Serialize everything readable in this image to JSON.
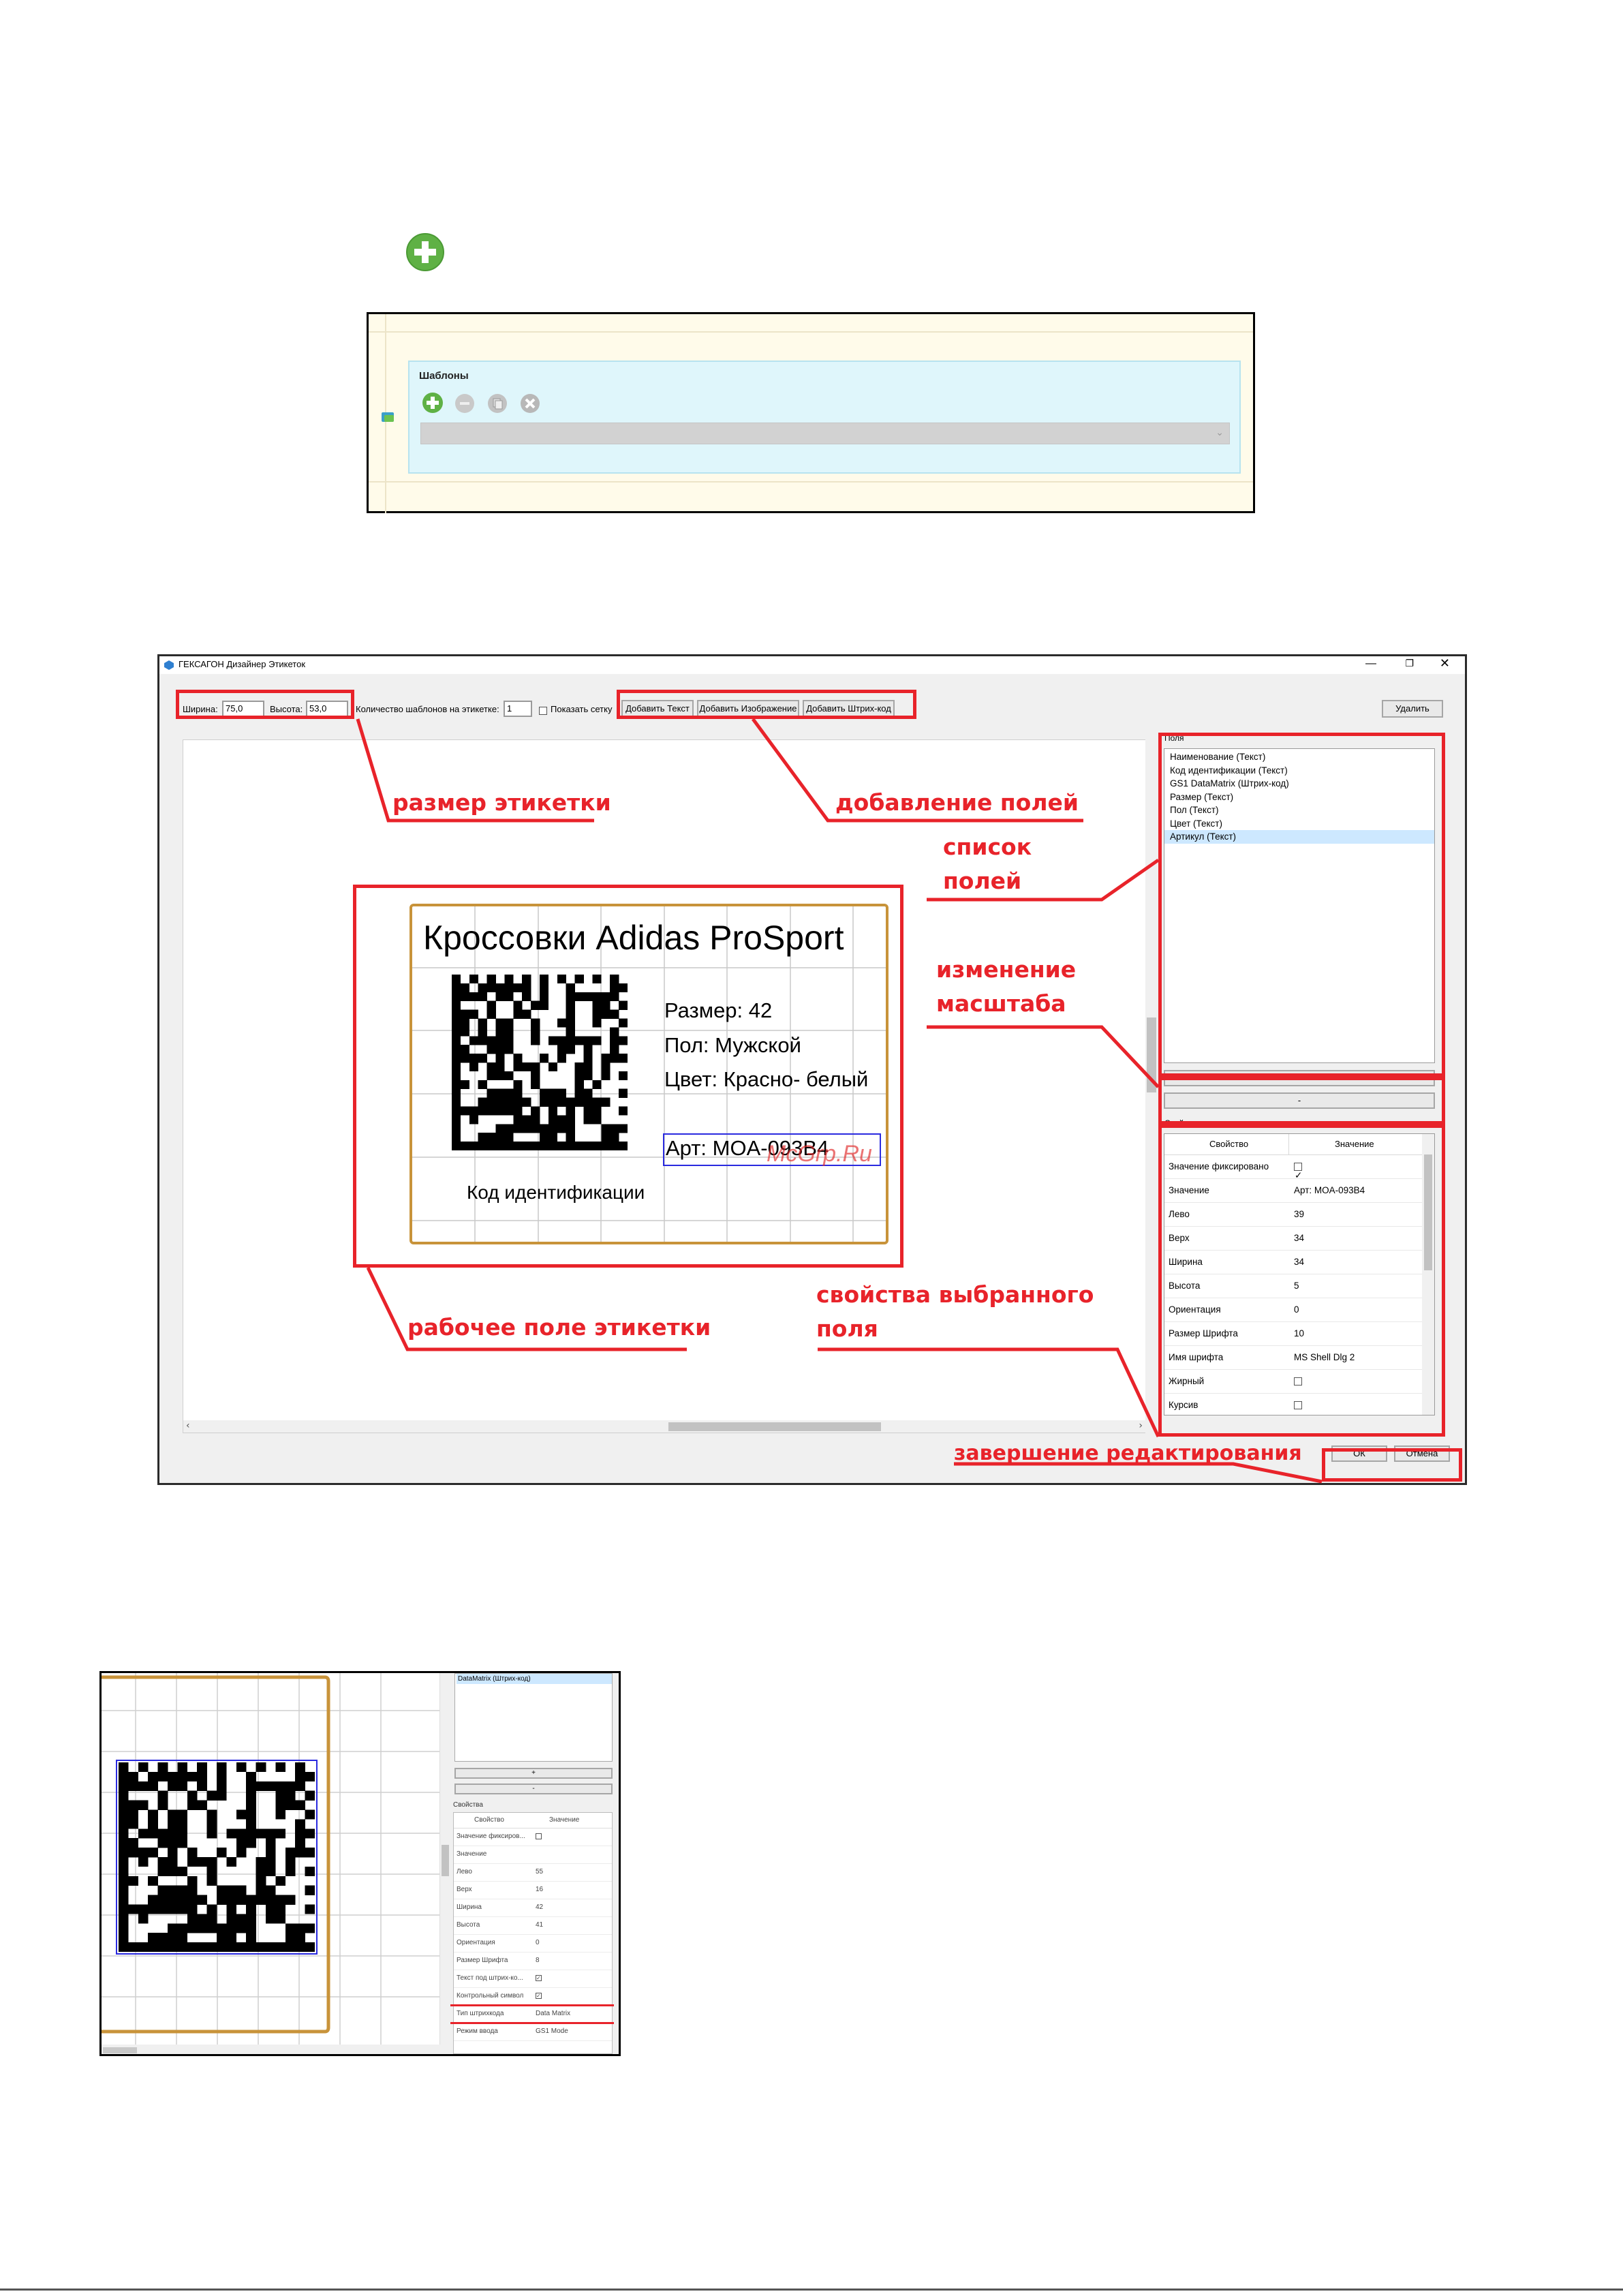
{
  "templates_panel": {
    "title": "Шаблоны",
    "add_icon": "plus-circle-icon",
    "edit_icon": "edit-icon",
    "copy_icon": "copy-icon",
    "delete_icon": "close-circle-icon"
  },
  "designer": {
    "window_title": "ГЕКСАГОН Дизайнер Этикеток",
    "toolbar": {
      "width_label": "Ширина:",
      "width_value": "75,0",
      "height_label": "Высота:",
      "height_value": "53,0",
      "count_label": "Количество шаблонов на этикетке:",
      "count_value": "1",
      "show_grid_label": "Показать сетку",
      "add_text": "Добавить Текст",
      "add_image": "Добавить Изображение",
      "add_barcode": "Добавить Штрих-код",
      "delete": "Удалить"
    },
    "label": {
      "title": "Кроссовки Adidas ProSport",
      "size": "Размер: 42",
      "gender": "Пол: Мужской",
      "color": "Цвет: Красно- белый",
      "article": "Арт: MOA-093B4",
      "code_caption": "Код идентификации"
    },
    "watermark": "McGrp.Ru",
    "fields_title": "Поля",
    "fields": [
      "Наименование (Текст)",
      "Код идентификации (Текст)",
      "GS1 DataMatrix (Штрих-код)",
      "Размер (Текст)",
      "Пол (Текст)",
      "Цвет (Текст)",
      "Артикул (Текст)"
    ],
    "zoom_in": "+",
    "zoom_out": "-",
    "properties_title": "Свойства",
    "prop_header": {
      "key": "Свойство",
      "value": "Значение"
    },
    "properties": [
      {
        "key": "Значение фиксировано",
        "value": ""
      },
      {
        "key": "Значение",
        "value": "Арт: MOA-093B4"
      },
      {
        "key": "Лево",
        "value": "39"
      },
      {
        "key": "Верх",
        "value": "34"
      },
      {
        "key": "Ширина",
        "value": "34"
      },
      {
        "key": "Высота",
        "value": "5"
      },
      {
        "key": "Ориентация",
        "value": "0"
      },
      {
        "key": "Размер Шрифта",
        "value": "10"
      },
      {
        "key": "Имя шрифта",
        "value": "MS Shell Dlg 2"
      },
      {
        "key": "Жирный",
        "value": ""
      },
      {
        "key": "Курсив",
        "value": ""
      }
    ],
    "ok": "ОК",
    "cancel": "Отмена"
  },
  "annotations": {
    "size": "размер этикетки",
    "add_fields": "добавление полей",
    "fields_list_1": "список",
    "fields_list_2": "полей",
    "zoom_1": "изменение",
    "zoom_2": "масштаба",
    "workspace": "рабочее поле этикетки",
    "props_1": "свойства выбранного",
    "props_2": "поля",
    "finish": "завершение редактирования"
  },
  "detail": {
    "list_item": "DataMatrix (Штрих-код)",
    "zoom_in": "+",
    "zoom_out": "-",
    "properties_title": "Свойства",
    "prop_header": {
      "key": "Свойство",
      "value": "Значение"
    },
    "properties": [
      {
        "key": "Значение фиксиров...",
        "value": ""
      },
      {
        "key": "Значение",
        "value": ""
      },
      {
        "key": "Лево",
        "value": "55"
      },
      {
        "key": "Верх",
        "value": "16"
      },
      {
        "key": "Ширина",
        "value": "42"
      },
      {
        "key": "Высота",
        "value": "41"
      },
      {
        "key": "Ориентация",
        "value": "0"
      },
      {
        "key": "Размер Шрифта",
        "value": "8"
      },
      {
        "key": "Текст под штрих-ко...",
        "value": ""
      },
      {
        "key": "Контрольный символ",
        "value": ""
      },
      {
        "key": "Тип штрихкода",
        "value": "Data Matrix"
      },
      {
        "key": "Режим ввода",
        "value": "GS1 Mode"
      }
    ]
  },
  "colors": {
    "annotation": "#e8232a",
    "panel": "#dff6fb",
    "frame": "#c8933a",
    "selection": "#2a2adf"
  }
}
